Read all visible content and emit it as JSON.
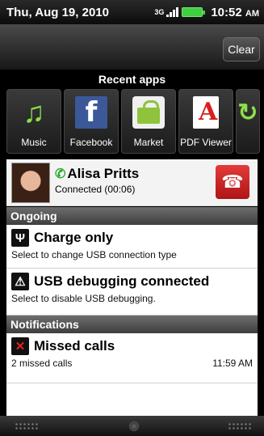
{
  "status_bar": {
    "date": "Thu, Aug 19, 2010",
    "network": "3G",
    "time": "10:52",
    "ampm": "AM"
  },
  "top_panel": {
    "clear_label": "Clear"
  },
  "recent_apps": {
    "title": "Recent apps",
    "apps": [
      {
        "label": "Music",
        "icon": "music-icon"
      },
      {
        "label": "Facebook",
        "icon": "facebook-icon"
      },
      {
        "label": "Market",
        "icon": "market-icon"
      },
      {
        "label": "PDF Viewer",
        "icon": "pdf-icon"
      },
      {
        "label": "",
        "icon": "refresh-icon"
      }
    ]
  },
  "call": {
    "name": "Alisa Pritts",
    "status": "Connected (00:06)",
    "accent": "#2eab2e",
    "end_color": "#d22a2a"
  },
  "ongoing": {
    "header": "Ongoing",
    "items": [
      {
        "title": "Charge only",
        "subtitle": "Select to change USB connection type",
        "icon": "usb-icon"
      },
      {
        "title": "USB debugging connected",
        "subtitle": "Select to disable USB debugging.",
        "icon": "warning-icon"
      }
    ]
  },
  "notifications": {
    "header": "Notifications",
    "items": [
      {
        "title": "Missed calls",
        "subtitle": "2 missed calls",
        "time": "11:59 AM",
        "icon": "missed-call-icon"
      }
    ]
  }
}
